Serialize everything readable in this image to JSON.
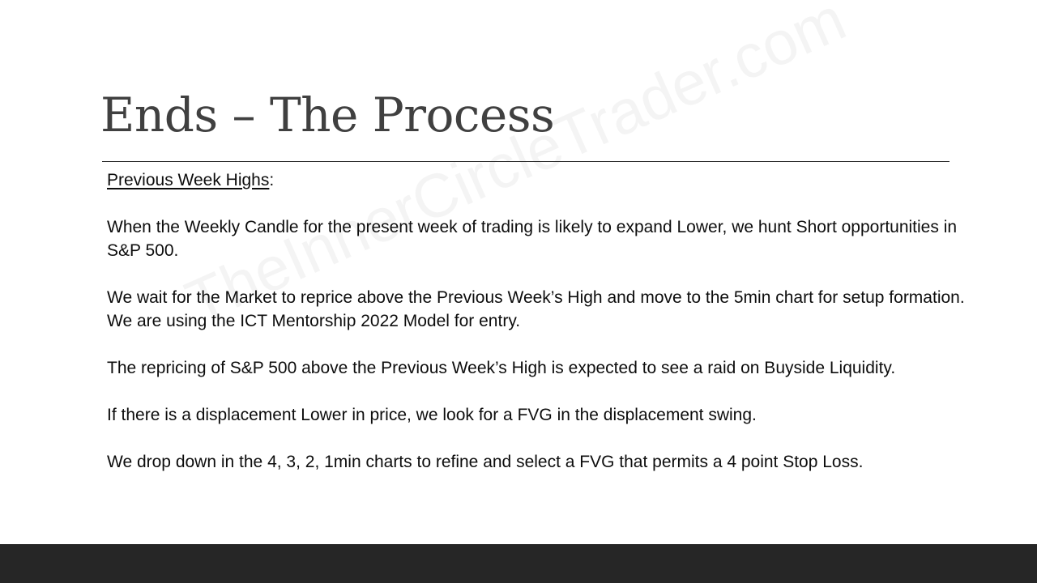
{
  "slide": {
    "title": "Ends – The Process",
    "watermark": "TheInnerCircleTrader.com",
    "heading": "Previous Week Highs",
    "heading_suffix": ":",
    "paragraphs": [
      "When the Weekly Candle for the present week of trading is likely to expand Lower, we hunt Short opportunities in S&P 500.",
      "We wait for the Market to reprice above the Previous Week’s High and move to the 5min chart for setup formation.  We are using the ICT Mentorship 2022 Model for entry.",
      "The repricing of S&P 500 above the Previous Week’s High is expected to see a raid on Buyside Liquidity.",
      "If there is a displacement Lower in price, we look for a FVG in the displacement swing.",
      "We drop down in the 4, 3, 2, 1min charts to refine and select a FVG that permits a 4 point Stop Loss."
    ]
  },
  "colors": {
    "title": "#404040",
    "text": "#0d0d0d",
    "rule": "#262626",
    "footer_bar": "#262626",
    "background": "#ffffff"
  }
}
